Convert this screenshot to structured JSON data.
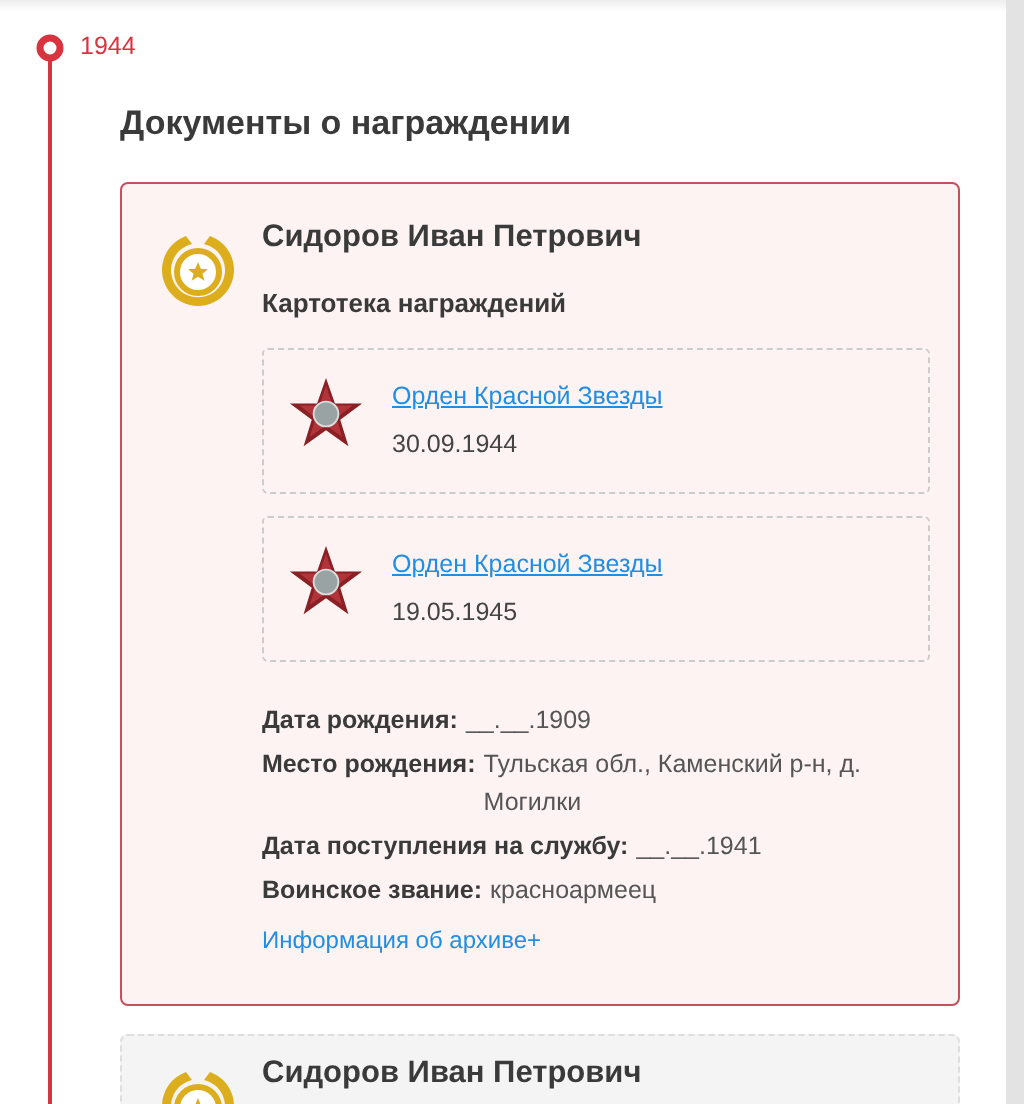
{
  "timeline": {
    "year": "1944"
  },
  "section_title": "Документы о награждении",
  "cards": [
    {
      "name": "Сидоров Иван Петрович",
      "subtitle": "Картотека награждений",
      "selected": true,
      "awards": [
        {
          "title": "Орден Красной Звезды",
          "date": "30.09.1944"
        },
        {
          "title": "Орден Красной Звезды",
          "date": "19.05.1945"
        }
      ],
      "details": [
        {
          "label": "Дата рождения:",
          "value": "__.__.1909"
        },
        {
          "label": "Место рождения:",
          "value": "Тульская обл., Каменский р-н, д. Могилки"
        },
        {
          "label": "Дата поступления на службу:",
          "value": "__.__.1941"
        },
        {
          "label": "Воинское звание:",
          "value": "красноармеец"
        }
      ],
      "archive_link": "Информация об архиве+"
    },
    {
      "name": "Сидоров Иван Петрович",
      "selected": false
    }
  ]
}
